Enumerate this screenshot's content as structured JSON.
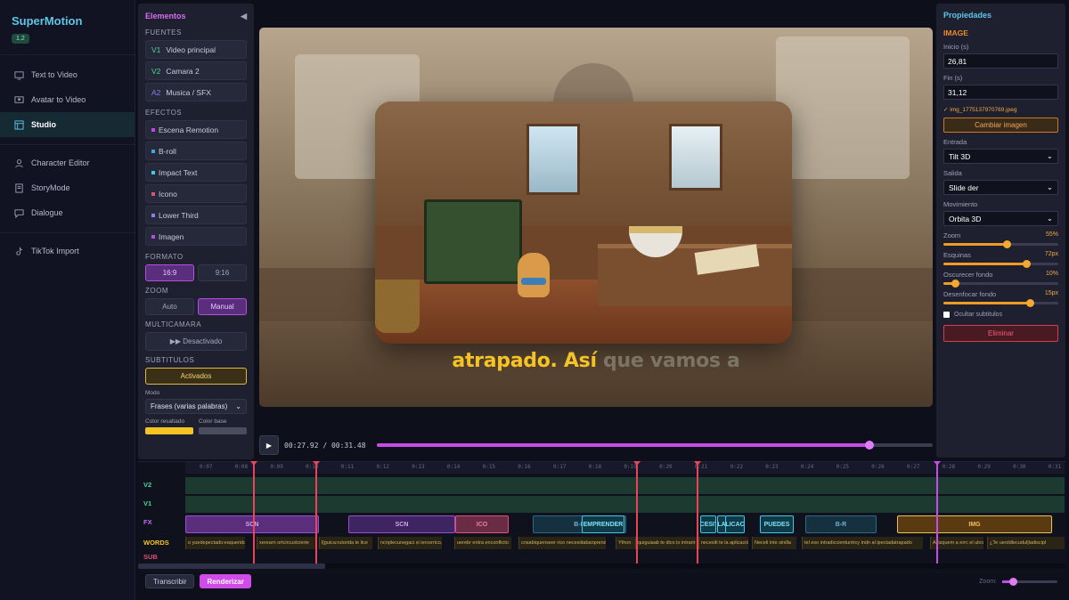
{
  "app": {
    "name": "SuperMotion",
    "version": "1.2"
  },
  "nav": {
    "items": [
      {
        "label": "Text to Video",
        "icon": "monitor-icon"
      },
      {
        "label": "Avatar to Video",
        "icon": "screen-user-icon"
      },
      {
        "label": "Studio",
        "icon": "layout-icon",
        "active": true
      },
      {
        "label": "Character Editor",
        "icon": "user-icon"
      },
      {
        "label": "StoryMode",
        "icon": "book-icon"
      },
      {
        "label": "Dialogue",
        "icon": "chat-icon"
      },
      {
        "label": "TikTok Import",
        "icon": "tiktok-icon"
      }
    ]
  },
  "elements": {
    "title": "Elementos",
    "collapse": "◀",
    "fuentes_label": "FUENTES",
    "sources": [
      {
        "tag": "V1",
        "label": "Video principal",
        "color": "#4fd1a0"
      },
      {
        "tag": "V2",
        "label": "Camara 2",
        "color": "#4fd1a0"
      },
      {
        "tag": "A2",
        "label": "Musica / SFX",
        "color": "#8a7ff0"
      }
    ],
    "efectos_label": "EFECTOS",
    "effects": [
      {
        "label": "Escena Remotion",
        "color": "#b54de0"
      },
      {
        "label": "B-roll",
        "color": "#3fa8d8"
      },
      {
        "label": "Impact Text",
        "color": "#3fc8e8"
      },
      {
        "label": "Icono",
        "color": "#e0507a"
      },
      {
        "label": "Lower Third",
        "color": "#8a7ff0"
      },
      {
        "label": "Imagen",
        "color": "#b54de0"
      }
    ],
    "formato_label": "FORMATO",
    "formato": [
      "16:9",
      "9:16"
    ],
    "zoom_label": "ZOOM",
    "zoom": [
      "Auto",
      "Manual"
    ],
    "multicamara_label": "MULTICAMARA",
    "multicamara_value": "▶▶  Desactivado",
    "subtitulos_label": "SUBTITULOS",
    "subtitulos_value": "Activados",
    "modo_label": "Modo",
    "modo_value": "Frases (varias palabras)",
    "color_resaltado_label": "Color resaltado",
    "color_base_label": "Color base",
    "color_resaltado": "#f6c325",
    "color_base": "#4a4d5e"
  },
  "preview": {
    "caption_highlight": "atrapado. Así",
    "caption_rest": " que vamos a"
  },
  "player": {
    "time": "00:27.92 / 00:31.48",
    "progress": 0.8869
  },
  "props": {
    "title": "Propiedades",
    "type": "IMAGE",
    "inicio_label": "Inicio (s)",
    "inicio": "26,81",
    "fin_label": "Fin (s)",
    "fin": "31,12",
    "file": "✓ img_1775137970769.jpeg",
    "change_image": "Cambiar imagen",
    "entrada_label": "Entrada",
    "entrada": "Tilt 3D",
    "salida_label": "Salida",
    "salida": "Slide der",
    "movimiento_label": "Movimiento",
    "movimiento": "Orbita 3D",
    "sliders": [
      {
        "label": "Zoom",
        "value": "55%",
        "level": 0.55
      },
      {
        "label": "Esquinas",
        "value": "72px",
        "level": 0.72
      },
      {
        "label": "Oscurecer fondo",
        "value": "10%",
        "level": 0.1
      },
      {
        "label": "Desenfocar fondo",
        "value": "15px",
        "level": 0.75
      }
    ],
    "hide_subs": "Ocultar subtitulos",
    "delete": "Eliminar"
  },
  "timeline": {
    "ticks": [
      "0:07",
      "0:08",
      "0:09",
      "0:10",
      "0:11",
      "0:12",
      "0:13",
      "0:14",
      "0:15",
      "0:16",
      "0:17",
      "0:18",
      "0:19",
      "0:20",
      "0:21",
      "0:22",
      "0:23",
      "0:24",
      "0:25",
      "0:26",
      "0:27",
      "0:28",
      "0:29",
      "0:30",
      "0:31"
    ],
    "lanes": [
      "V2",
      "V1",
      "FX",
      "WORDS",
      "SUB"
    ],
    "lane_colors": [
      "#4fd1a0",
      "#4fd1a0",
      "#c86bf0",
      "#f6c325",
      "#e0507a"
    ],
    "fx_clips": [
      {
        "label": "SCN",
        "color": "#5a2d7d",
        "border": "#9a4fd0",
        "text": "#d7a3f0"
      },
      {
        "label": "SCN",
        "color": "#3e2460",
        "border": "#9a4fd0",
        "text": "#d7a3f0"
      },
      {
        "label": "ICO",
        "color": "#6a2b45",
        "border": "#e0507a",
        "text": "#f07ca0"
      },
      {
        "label": "B-R",
        "color": "#15313f",
        "border": "#2e6a86",
        "text": "#6fb4d0"
      },
      {
        "label": "EMPRENDER",
        "color": "#0f3a48",
        "border": "#3fc8e8",
        "text": "#7fe0f5"
      },
      {
        "label": "ICESIT",
        "color": "#0f3a48",
        "border": "#3fc8e8",
        "text": "#7fe0f5"
      },
      {
        "label": "LA",
        "color": "#0f3a48",
        "border": "#3fc8e8",
        "text": "#7fe0f5"
      },
      {
        "label": "LICAC",
        "color": "#0f3a48",
        "border": "#3fc8e8",
        "text": "#7fe0f5"
      },
      {
        "label": "PUEDES",
        "color": "#0f3a48",
        "border": "#3fc8e8",
        "text": "#7fe0f5"
      },
      {
        "label": "B-R",
        "color": "#15313f",
        "border": "#2e6a86",
        "text": "#6fb4d0"
      },
      {
        "label": "IMG",
        "color": "#5a3a10",
        "border": "#f0c050",
        "text": "#f5c060"
      }
    ],
    "words": [
      "o yuedepectado:eaquerido",
      "xerearn ortcircustcierte",
      "l[guica:rutorida te lice",
      "ncnplecunegaci si iercerrico,",
      "uerebr entra enconflicto",
      "cnsabiquenseer rico necesiitabanprende",
      "Ython",
      "quiguiaab te dico lo intrarir",
      "necesiti te la aplicación",
      "Neceli inte sinilla",
      "tel eso intradiccientuntrcy indn al ipectadatrapado",
      "Asisquem a  errc el ulrculo",
      "¿Te uerddlecudul|ladiscipl"
    ],
    "markers": [
      "#e8445a",
      "#e8445a",
      "#e8445a",
      "#e8445a",
      "#c84be8"
    ]
  },
  "bottom": {
    "transcribir": "Transcribir",
    "renderizar": "Renderizar",
    "zoom_label": "Zoom:",
    "zoom_level": 0.2
  }
}
